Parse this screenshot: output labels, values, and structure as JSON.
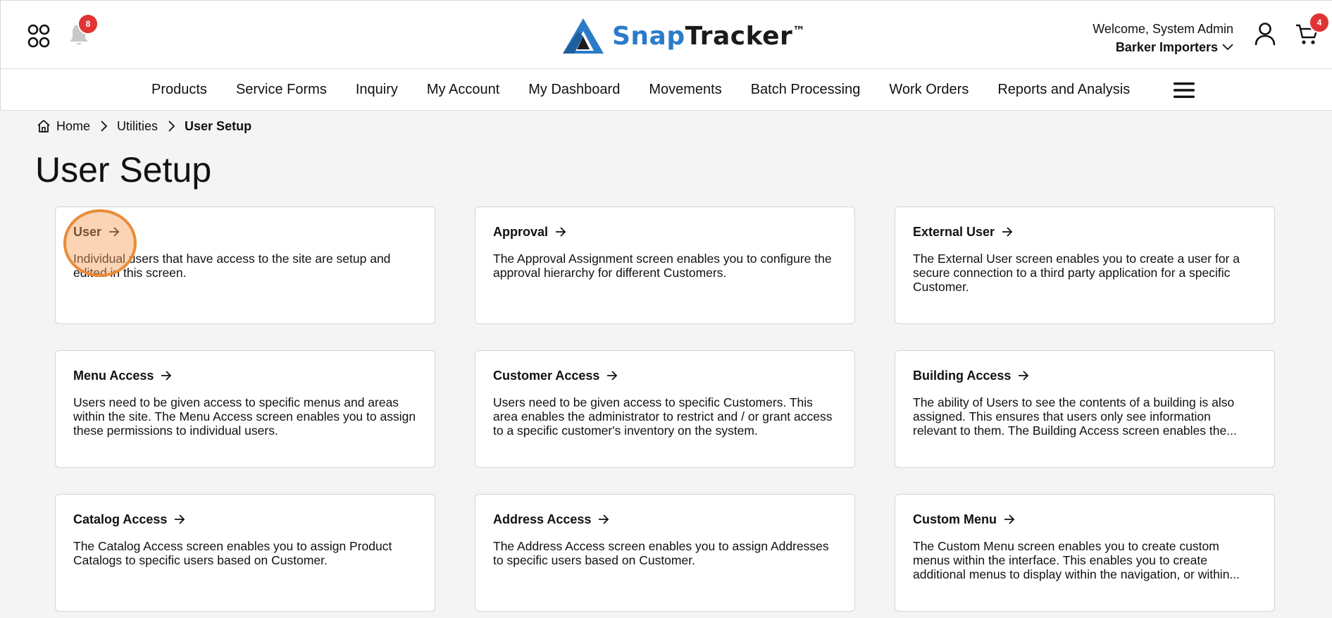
{
  "header": {
    "notification_count": "8",
    "cart_count": "4",
    "logo_snap": "Snap",
    "logo_tracker": "Tracker",
    "logo_tm": "™",
    "welcome": "Welcome, System Admin",
    "company": "Barker Importers",
    "icons": [
      "apps-icon",
      "bell-icon",
      "user-icon",
      "cart-icon"
    ]
  },
  "nav": {
    "items": [
      "Products",
      "Service Forms",
      "Inquiry",
      "My Account",
      "My Dashboard",
      "Movements",
      "Batch Processing",
      "Work Orders",
      "Reports and Analysis"
    ]
  },
  "breadcrumb": {
    "home": "Home",
    "utilities": "Utilities",
    "current": "User Setup"
  },
  "page": {
    "title": "User Setup"
  },
  "cards": [
    {
      "title": "User",
      "desc": "Individual users that have access to the site are setup and edited in this screen."
    },
    {
      "title": "Approval",
      "desc": "The Approval Assignment screen enables you to configure the approval hierarchy for different Customers."
    },
    {
      "title": "External User",
      "desc": "The External User screen enables you to create a user for a secure connection to a third party application for a specific Customer."
    },
    {
      "title": "Menu Access",
      "desc": "Users need to be given access to specific menus and areas within the site. The Menu Access screen enables you to assign these permissions to individual users."
    },
    {
      "title": "Customer Access",
      "desc": "Users need to be given access to specific Customers. This area enables the administrator to restrict and / or grant access to a specific customer's inventory on the system."
    },
    {
      "title": "Building Access",
      "desc": "The ability of Users to see the contents of a building is also assigned. This ensures that users only see information relevant to them. The Building Access screen enables the..."
    },
    {
      "title": "Catalog Access",
      "desc": "The Catalog Access screen enables you to assign Product Catalogs to specific users based on Customer."
    },
    {
      "title": "Address Access",
      "desc": "The Address Access screen enables you to assign Addresses to specific users based on Customer."
    },
    {
      "title": "Custom Menu",
      "desc": "The Custom Menu screen enables you to create custom menus within the interface. This enables you to create additional menus to display within the navigation, or within..."
    }
  ],
  "colors": {
    "brand_blue": "#2b7bc9",
    "badge_red": "#e03434",
    "highlight_orange": "#e98c3a"
  }
}
